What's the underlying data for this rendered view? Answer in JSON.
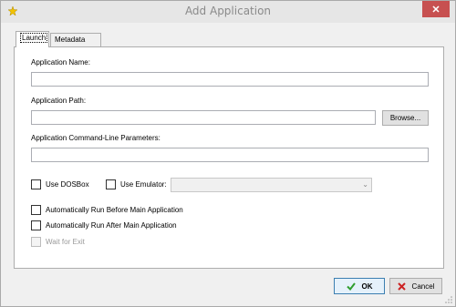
{
  "window": {
    "title": "Add Application",
    "close_label": "✕"
  },
  "tabs": [
    {
      "label": "Launch"
    },
    {
      "label": "Metadata"
    }
  ],
  "form": {
    "app_name_label": "Application Name:",
    "app_name_value": "",
    "app_path_label": "Application Path:",
    "app_path_value": "",
    "browse_label": "Browse...",
    "params_label": "Application Command-Line Parameters:",
    "params_value": "",
    "use_dosbox_label": "Use DOSBox",
    "use_dosbox_checked": false,
    "use_emulator_label": "Use Emulator:",
    "use_emulator_checked": false,
    "emulator_selected": "",
    "auto_before_label": "Automatically Run Before Main Application",
    "auto_before_checked": false,
    "auto_after_label": "Automatically Run After Main Application",
    "auto_after_checked": false,
    "wait_exit_label": "Wait for Exit",
    "wait_exit_checked": false
  },
  "buttons": {
    "ok_label": "OK",
    "cancel_label": "Cancel"
  },
  "icons": {
    "app": "star-icon",
    "ok": "check-icon",
    "cancel": "x-icon"
  },
  "colors": {
    "ok_check": "#2e9e2e",
    "cancel_x": "#cc2222",
    "close_button": "#c75050"
  }
}
